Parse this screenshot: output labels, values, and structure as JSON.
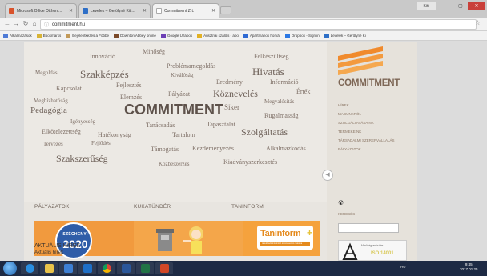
{
  "browser": {
    "tabs": [
      {
        "label": "Microsoft Office Otthoni...",
        "favicon_color": "#d9532c"
      },
      {
        "label": "Levelek – Gerölyné Kiti...",
        "favicon_color": "#2e6fc7"
      },
      {
        "label": "Commitment Zrt.",
        "favicon_color": "#ffffff"
      }
    ],
    "url": "commitment.hu",
    "user_label": "Kiti"
  },
  "bookmarks": [
    {
      "label": "Alkalmazások",
      "color": "#4f7bd6"
    },
    {
      "label": "Bookmarks",
      "color": "#d8b436"
    },
    {
      "label": "Bejelentkezés a Főbbe",
      "color": "#c29a5a"
    },
    {
      "label": "Downton Abbey online",
      "color": "#7b4a2a"
    },
    {
      "label": "Google Űrlapok",
      "color": "#6c3fb5"
    },
    {
      "label": "Ausztriai szállás - apo",
      "color": "#e2b124"
    },
    {
      "label": "Apartmanok horvát",
      "color": "#2f6ad3"
    },
    {
      "label": "Dropbox - Sign in",
      "color": "#2b78e4"
    },
    {
      "label": "Levelek – Gerölyné Ki",
      "color": "#2e6fc7"
    }
  ],
  "cloud": [
    {
      "text": "Innováció",
      "size": 8
    },
    {
      "text": "Minőség",
      "size": 8
    },
    {
      "text": "Problémamegoldás",
      "size": 8
    },
    {
      "text": "Felkészültség",
      "size": 8
    },
    {
      "text": "Megoldás",
      "size": 7
    },
    {
      "text": "Szakképzés",
      "size": 13
    },
    {
      "text": "Kiválóság",
      "size": 7
    },
    {
      "text": "Hivatás",
      "size": 13
    },
    {
      "text": "Kapcsolat",
      "size": 8
    },
    {
      "text": "Fejlesztés",
      "size": 8
    },
    {
      "text": "Eredmény",
      "size": 8
    },
    {
      "text": "Információ",
      "size": 8
    },
    {
      "text": "Megbízhatóság",
      "size": 7
    },
    {
      "text": "Elemzés",
      "size": 8
    },
    {
      "text": "Pályázat",
      "size": 8
    },
    {
      "text": "Köznevelés",
      "size": 12
    },
    {
      "text": "Érték",
      "size": 8
    },
    {
      "text": "Pedagógia",
      "size": 11
    },
    {
      "text": "COMMITMENT",
      "size": 18
    },
    {
      "text": "Siker",
      "size": 9
    },
    {
      "text": "Megvalósítás",
      "size": 7
    },
    {
      "text": "Igényesség",
      "size": 7
    },
    {
      "text": "Tanácsadás",
      "size": 8
    },
    {
      "text": "Tapasztalat",
      "size": 8
    },
    {
      "text": "Rugalmasság",
      "size": 8
    },
    {
      "text": "Elkötelezettség",
      "size": 8
    },
    {
      "text": "Hatékonyság",
      "size": 8
    },
    {
      "text": "Tartalom",
      "size": 8
    },
    {
      "text": "Szolgáltatás",
      "size": 12
    },
    {
      "text": "Tervezés",
      "size": 7
    },
    {
      "text": "Fejlődés",
      "size": 7
    },
    {
      "text": "Támogatás",
      "size": 8
    },
    {
      "text": "Kezdeményezés",
      "size": 8
    },
    {
      "text": "Alkalmazkodás",
      "size": 8
    },
    {
      "text": "Szakszerűség",
      "size": 12
    },
    {
      "text": "Közbeszerzés",
      "size": 7
    },
    {
      "text": "Kiadványszerkesztés",
      "size": 8
    }
  ],
  "sidebar": {
    "logo": "COMMITMENT",
    "menu": [
      "HÍREK",
      "MAGUNKRÓL",
      "SZOLGÁLTATÁSAINK",
      "TERMÉKEINK",
      "TÁRSADALMI SZEREPVÁLLALÁS",
      "PÁLYÁZATOK"
    ],
    "search_label": "KERESÉS",
    "partner_caption": "Minőségtanúsítás",
    "partner_iso": "ISO 14001"
  },
  "sections": {
    "palyazatok": "PÁLYÁZATOK",
    "kukatunder": "KUKATÜNDÉR",
    "taninform": "TANINFORM"
  },
  "banners": {
    "szech_top": "SZÉCHENYI",
    "szech_year": "2020",
    "tani_word": "Taninform",
    "tani_plus": "+",
    "tani_sub": "tanulói adminisztráció és szervezési csatorna"
  },
  "news": {
    "heading": "AKTUÁLIS HÍREK",
    "subheading": "Aktuális hírek"
  },
  "taskbar": {
    "tray": "HU",
    "time": "9:45",
    "date": "2017.01.25"
  },
  "colors": {
    "accent_orange": "#f19a3e",
    "cloud_text": "#7e6f66",
    "logo_brown": "#7d6655"
  }
}
